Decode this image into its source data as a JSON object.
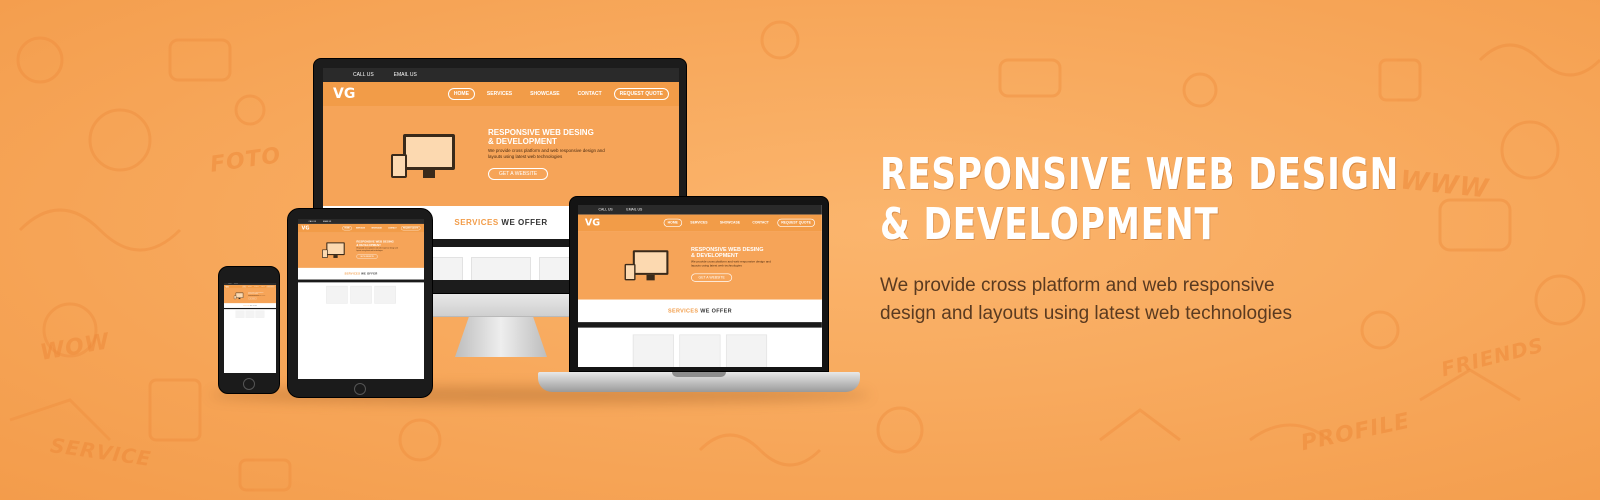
{
  "banner": {
    "headline_line1": "Responsive Web Design",
    "headline_line2": "& Development",
    "subtext_line1": "We provide cross platform and web responsive",
    "subtext_line2": "design and layouts using latest web technologies"
  },
  "mockup_site": {
    "logo": "VG",
    "top_call": "CALL US",
    "top_email": "EMAIL US",
    "menu": [
      "HOME",
      "SERVICES",
      "SHOWCASE",
      "CONTACT",
      "REQUEST QUOTE"
    ],
    "hero_title": "RESPONSIVE WEB DESING & DEVELOPMENT",
    "hero_sub": "We provide cross platform and web responsive design and layouts using latest web technologies",
    "hero_button": "GET A WEBSITE",
    "services_title_a": "SERVICES",
    "services_title_b": "WE OFFER"
  },
  "doodles": [
    "FOTO",
    "WWW",
    "WOW",
    "SERVICE",
    "PROFILE",
    "FRIENDS"
  ],
  "colors": {
    "background": "#f6a75a",
    "headline": "#ffffff",
    "subtext": "#5a3a20",
    "accent": "#f29c48"
  }
}
